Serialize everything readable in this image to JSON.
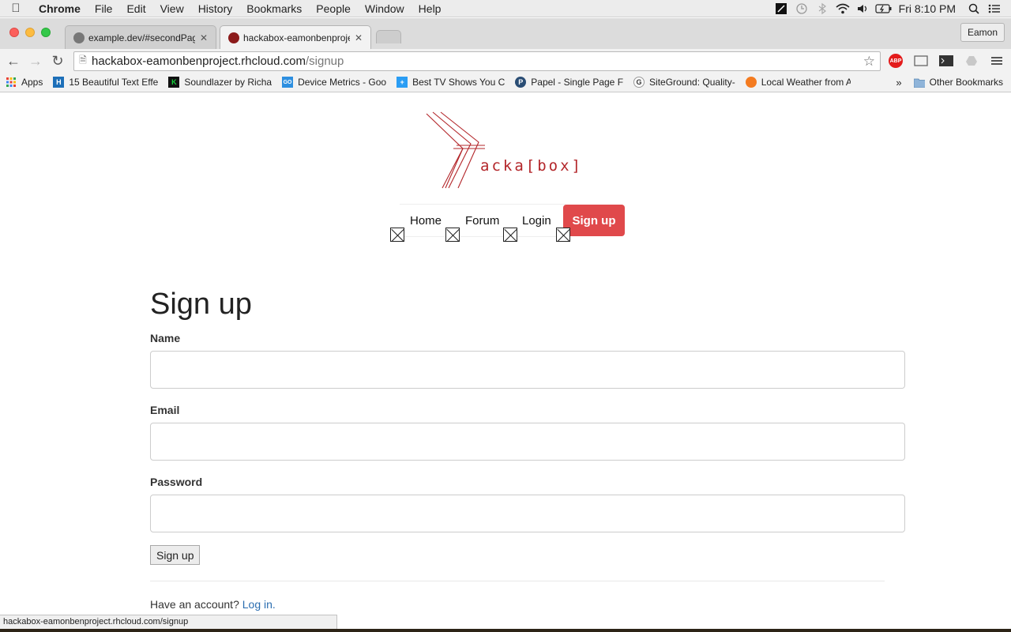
{
  "menubar": {
    "app_name": "Chrome",
    "items": [
      "File",
      "Edit",
      "View",
      "History",
      "Bookmarks",
      "People",
      "Window",
      "Help"
    ],
    "clock": "Fri 8:10 PM"
  },
  "tabs": [
    {
      "title": "example.dev/#secondPage",
      "favicon_color": "#777777"
    },
    {
      "title": "hackabox-eamonbenprojec",
      "favicon_color": "#8b1a1a"
    }
  ],
  "profile": "Eamon",
  "address": {
    "host": "hackabox-eamonbenproject.rhcloud.com",
    "path": "/signup"
  },
  "bookmarks": [
    {
      "label": "Apps",
      "icon": "apps-grid-icon",
      "color": "#e94235"
    },
    {
      "label": "15 Beautiful Text Effe",
      "icon": "H",
      "color": "#1d6fb8"
    },
    {
      "label": "Soundlazer by Richa",
      "icon": "K",
      "color": "#14a13a"
    },
    {
      "label": "Device Metrics - Goo",
      "icon": "GO",
      "color": "#2d8fe0"
    },
    {
      "label": "Best TV Shows You C",
      "icon": "+",
      "color": "#2a9df4"
    },
    {
      "label": "Papel - Single Page F",
      "icon": "P",
      "color": "#2a4d74"
    },
    {
      "label": "SiteGround: Quality-",
      "icon": "G",
      "color": "#7a7a7a"
    },
    {
      "label": "Local Weather from A",
      "icon": "sun",
      "color": "#f47b20"
    }
  ],
  "bookmarks_more": "»",
  "other_bookmarks": "Other Bookmarks",
  "site": {
    "logo_text": "acka[box]",
    "nav": [
      "Home",
      "Forum",
      "Login"
    ],
    "nav_cta": "Sign up"
  },
  "form": {
    "title": "Sign up",
    "fields": [
      {
        "label": "Name",
        "value": ""
      },
      {
        "label": "Email",
        "value": ""
      },
      {
        "label": "Password",
        "value": ""
      }
    ],
    "submit": "Sign up",
    "have_account": "Have an account?",
    "login_link": "Log in."
  },
  "status_url": "hackabox-eamonbenproject.rhcloud.com/signup",
  "colors": {
    "brand_red": "#e0494b",
    "link_blue": "#2a6db0"
  }
}
